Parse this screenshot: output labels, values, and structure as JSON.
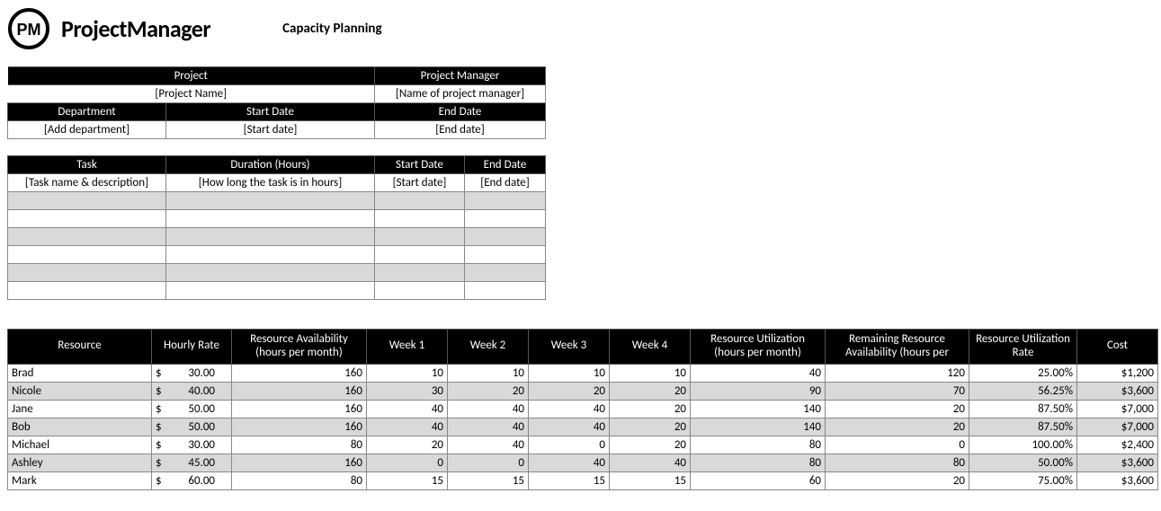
{
  "brand": "ProjectManager",
  "page_title": "Capacity Planning",
  "meta": {
    "project_hdr": "Project",
    "pm_hdr": "Project Manager",
    "project_val": "[Project Name]",
    "pm_val": "[Name of project manager]",
    "dept_hdr": "Department",
    "start_hdr": "Start Date",
    "end_hdr": "End Date",
    "dept_val": "[Add department]",
    "start_val": "[Start date]",
    "end_val": "[End date]"
  },
  "tasks": {
    "task_hdr": "Task",
    "dur_hdr": "Duration (Hours)",
    "start_hdr": "Start Date",
    "end_hdr": "End Date",
    "sample": {
      "task": "[Task name & description]",
      "dur": "[How long the task is in hours]",
      "start": "[Start date]",
      "end": "[End date]"
    }
  },
  "res_headers": {
    "resource": "Resource",
    "rate": "Hourly Rate",
    "avail": "Resource Availability (hours per month)",
    "w1": "Week 1",
    "w2": "Week 2",
    "w3": "Week 3",
    "w4": "Week 4",
    "util": "Resource Utilization (hours per month)",
    "remain": "Remaining Resource Availability (hours per",
    "rateu": "Resource Utilization Rate",
    "cost": "Cost"
  },
  "resources": [
    {
      "name": "Brad",
      "sym": "$",
      "rate": "30.00",
      "avail": "160",
      "w1": "10",
      "w2": "10",
      "w3": "10",
      "w4": "10",
      "util": "40",
      "remain": "120",
      "rateu": "25.00%",
      "cost": "$1,200"
    },
    {
      "name": "Nicole",
      "sym": "$",
      "rate": "40.00",
      "avail": "160",
      "w1": "30",
      "w2": "20",
      "w3": "20",
      "w4": "20",
      "util": "90",
      "remain": "70",
      "rateu": "56.25%",
      "cost": "$3,600"
    },
    {
      "name": "Jane",
      "sym": "$",
      "rate": "50.00",
      "avail": "160",
      "w1": "40",
      "w2": "40",
      "w3": "40",
      "w4": "20",
      "util": "140",
      "remain": "20",
      "rateu": "87.50%",
      "cost": "$7,000"
    },
    {
      "name": "Bob",
      "sym": "$",
      "rate": "50.00",
      "avail": "160",
      "w1": "40",
      "w2": "40",
      "w3": "40",
      "w4": "20",
      "util": "140",
      "remain": "20",
      "rateu": "87.50%",
      "cost": "$7,000"
    },
    {
      "name": "Michael",
      "sym": "$",
      "rate": "30.00",
      "avail": "80",
      "w1": "20",
      "w2": "40",
      "w3": "0",
      "w4": "20",
      "util": "80",
      "remain": "0",
      "rateu": "100.00%",
      "cost": "$2,400"
    },
    {
      "name": "Ashley",
      "sym": "$",
      "rate": "45.00",
      "avail": "160",
      "w1": "0",
      "w2": "0",
      "w3": "40",
      "w4": "40",
      "util": "80",
      "remain": "80",
      "rateu": "50.00%",
      "cost": "$3,600"
    },
    {
      "name": "Mark",
      "sym": "$",
      "rate": "60.00",
      "avail": "80",
      "w1": "15",
      "w2": "15",
      "w3": "15",
      "w4": "15",
      "util": "60",
      "remain": "20",
      "rateu": "75.00%",
      "cost": "$3,600"
    }
  ]
}
